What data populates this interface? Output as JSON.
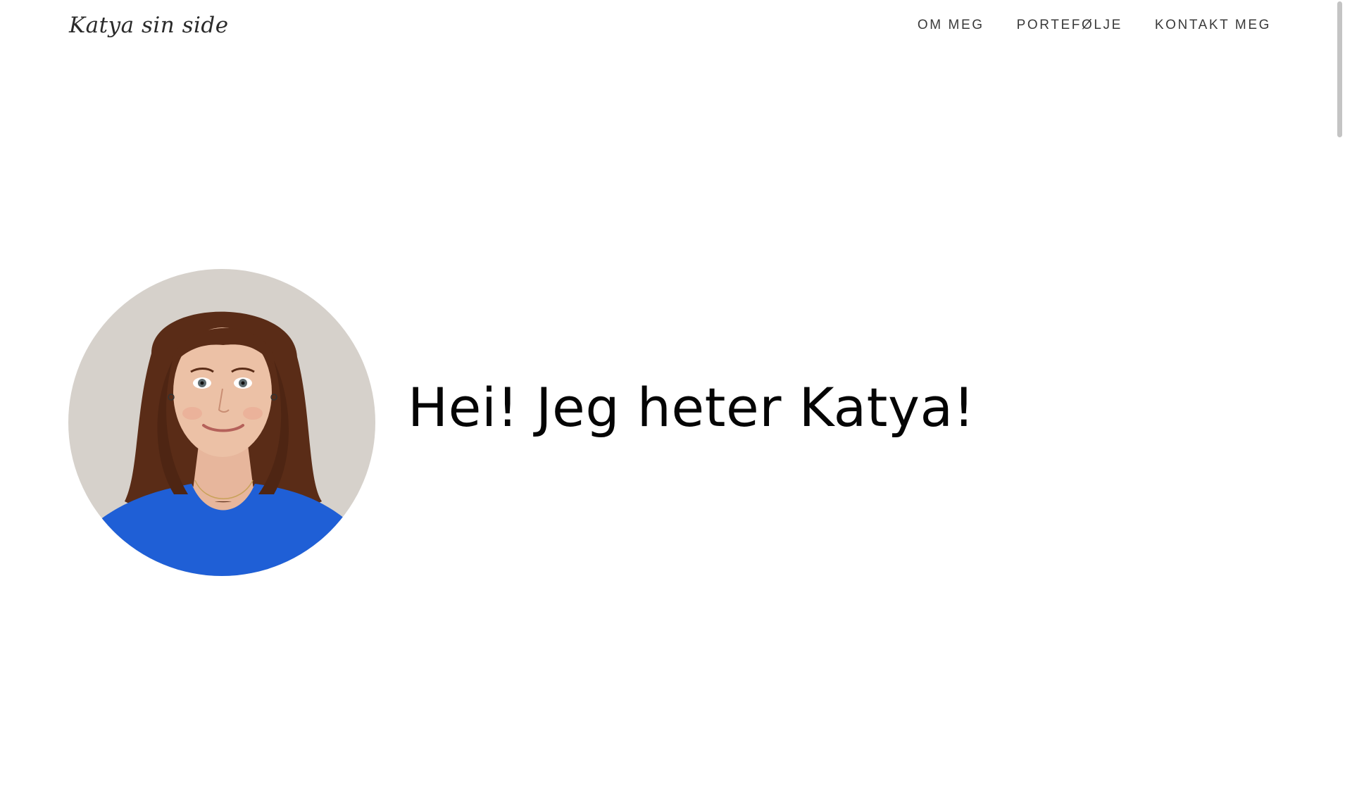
{
  "header": {
    "brand": "Katya sin side",
    "nav": [
      {
        "label": "OM MEG"
      },
      {
        "label": "PORTEFØLJE"
      },
      {
        "label": "KONTAKT MEG"
      }
    ]
  },
  "hero": {
    "title": "Hei! Jeg heter Katya!",
    "photo_alt": "portrait-photo"
  },
  "colors": {
    "background": "#ffffff",
    "text": "#111111",
    "nav_text": "#3a3a3a",
    "shirt": "#1f5fd6",
    "hair": "#5a2c17"
  }
}
